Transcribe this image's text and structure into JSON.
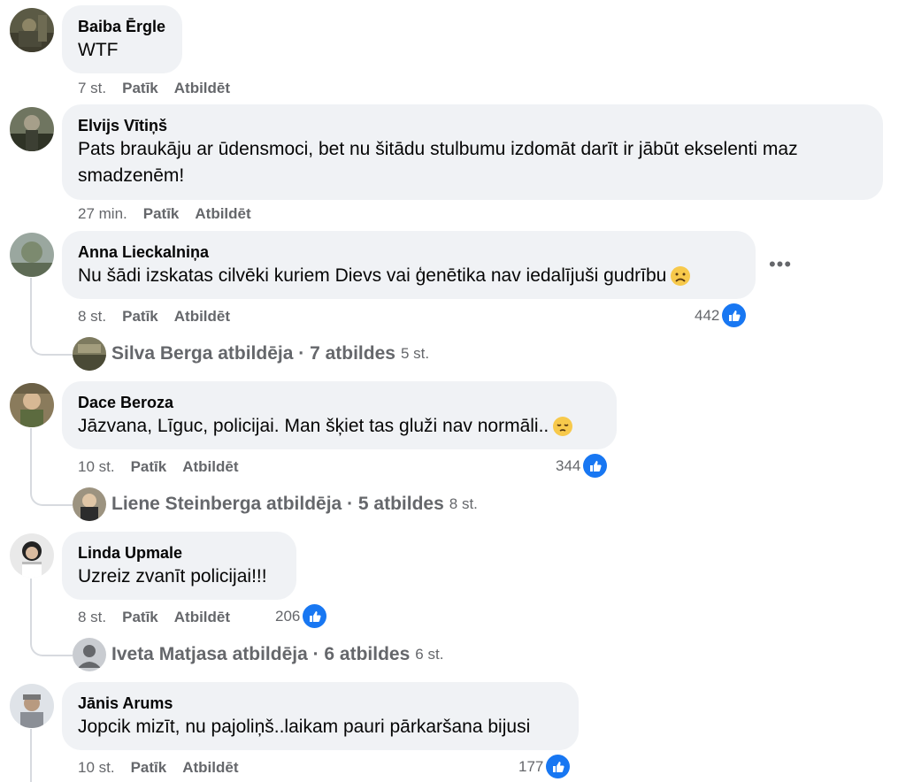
{
  "comments": [
    {
      "author": "Baiba Ērgle",
      "text": "WTF",
      "time": "7 st.",
      "like_label": "Patīk",
      "reply_label": "Atbildēt"
    },
    {
      "author": "Elvijs Vītiņš",
      "text": "Pats braukāju ar ūdensmoci, bet nu šitādu stulbumu izdomāt darīt ir jābūt ekselenti maz smadzenēm!",
      "time": "27 min.",
      "like_label": "Patīk",
      "reply_label": "Atbildēt"
    },
    {
      "author": "Anna Lieckalniņa",
      "text": "Nu šādi izskatas cilvēki kuriem Dievs vai ģenētika nav iedalījuši gudrību",
      "emoji": "frowning-face",
      "time": "8 st.",
      "like_label": "Patīk",
      "reply_label": "Atbildēt",
      "reactions": "442",
      "replies": {
        "text": "Silva Berga atbildēja · 7 atbildes",
        "time": "5 st."
      }
    },
    {
      "author": "Dace Beroza",
      "text": "Jāzvana, Līguc, policijai. Man šķiet tas gluži nav normāli..",
      "emoji": "pensive-face",
      "time": "10 st.",
      "like_label": "Patīk",
      "reply_label": "Atbildēt",
      "reactions": "344",
      "replies": {
        "text": "Liene Steinberga atbildēja · 5 atbildes",
        "time": "8 st."
      }
    },
    {
      "author": "Linda Upmale",
      "text": "Uzreiz zvanīt policijai!!!",
      "time": "8 st.",
      "like_label": "Patīk",
      "reply_label": "Atbildēt",
      "reactions": "206",
      "replies": {
        "text": "Iveta Matjasa atbildēja · 6 atbildes",
        "time": "6 st."
      }
    },
    {
      "author": "Jānis Arums",
      "text": "Jopcik mizīt, nu pajoliņš..laikam pauri pārkaršana bijusi",
      "time": "10 st.",
      "like_label": "Patīk",
      "reply_label": "Atbildēt",
      "reactions": "177"
    }
  ],
  "icons": {
    "more": "more-horizontal-icon",
    "like": "thumbs-up-icon",
    "accent": "#1877f2"
  }
}
